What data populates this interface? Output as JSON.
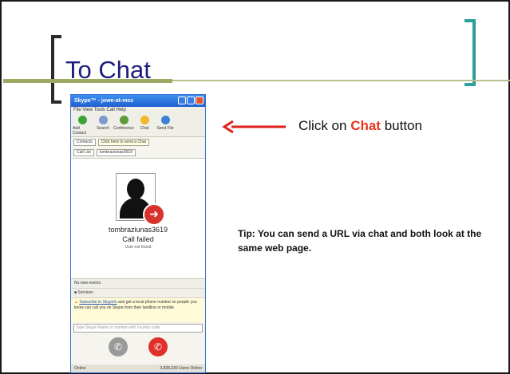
{
  "slide": {
    "title": "To Chat",
    "callout_prefix": "Click on ",
    "callout_highlight": "Chat",
    "callout_suffix": " button",
    "tip": "Tip:  You can send a URL via chat and both look at the same web page."
  },
  "skype": {
    "window_title": "Skype™ - jowe-at-mcc",
    "menu": "File  View  Tools  Call  Help",
    "toolbar": [
      "Add Contact",
      "Search",
      "Conference",
      "Chat",
      "Send File"
    ],
    "tooltip": "Click here to send a Chat",
    "tabs": [
      "Contacts",
      "Call List",
      "tombraziunas3619"
    ],
    "call_name": "tombraziunas3619",
    "call_status": "Call failed",
    "call_sub": "User not found",
    "no_events": "No new events",
    "services": "Services",
    "promo_link": "Subscribe to SkypeIn",
    "promo_text": " and get a local phone number so people you know can call you on Skype from their landline or mobile.",
    "input_placeholder": "Type Skype Name or number with country code",
    "status_left": "Online",
    "status_right": "3,828,330 Users Online"
  },
  "colors": {
    "accent": "#e8321e",
    "title": "#1c1c7c",
    "bracket_right": "#2e9f9a",
    "title_bar": "#9bab63"
  }
}
